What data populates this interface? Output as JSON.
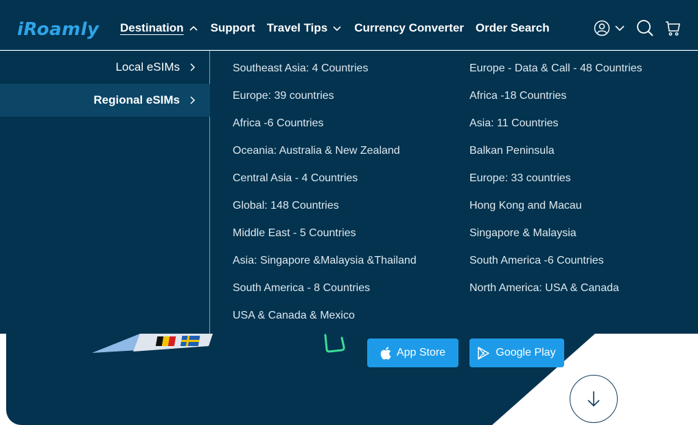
{
  "brand": {
    "logo_text": "iRoamly",
    "accent": "#2fa4e7",
    "bg": "#03334f"
  },
  "nav": {
    "items": [
      {
        "label": "Destination",
        "caret": "chevron-up"
      },
      {
        "label": "Support"
      },
      {
        "label": "Travel Tips",
        "caret": "chevron-down"
      },
      {
        "label": "Currency Converter"
      },
      {
        "label": "Order Search"
      }
    ],
    "icons": [
      "user-icon",
      "chevron-down-icon",
      "search-icon",
      "cart-icon"
    ]
  },
  "menu": {
    "categories": [
      {
        "label": "Local eSIMs"
      },
      {
        "label": "Regional eSIMs"
      }
    ],
    "column1": [
      "Southeast Asia: 4 Countries",
      "Europe: 39 countries",
      "Africa -6 Countries",
      "Oceania: Australia & New Zealand",
      "Central Asia - 4 Countries",
      "Global: 148 Countries",
      "Middle East - 5 Countries",
      "Asia: Singapore &Malaysia &Thailand",
      "South America - 8 Countries",
      "USA & Canada & Mexico"
    ],
    "column2": [
      "Europe - Data & Call - 48 Countries",
      "Africa -18 Countries",
      "Asia: 11 Countries",
      "Balkan Peninsula",
      "Europe: 33 countries",
      "Hong Kong and Macau",
      "Singapore & Malaysia",
      "South America -6 Countries",
      "North America: USA & Canada"
    ]
  },
  "hero": {
    "app_store_label": "App Store",
    "google_play_label": "Google Play",
    "button_color": "#1e9be8"
  }
}
